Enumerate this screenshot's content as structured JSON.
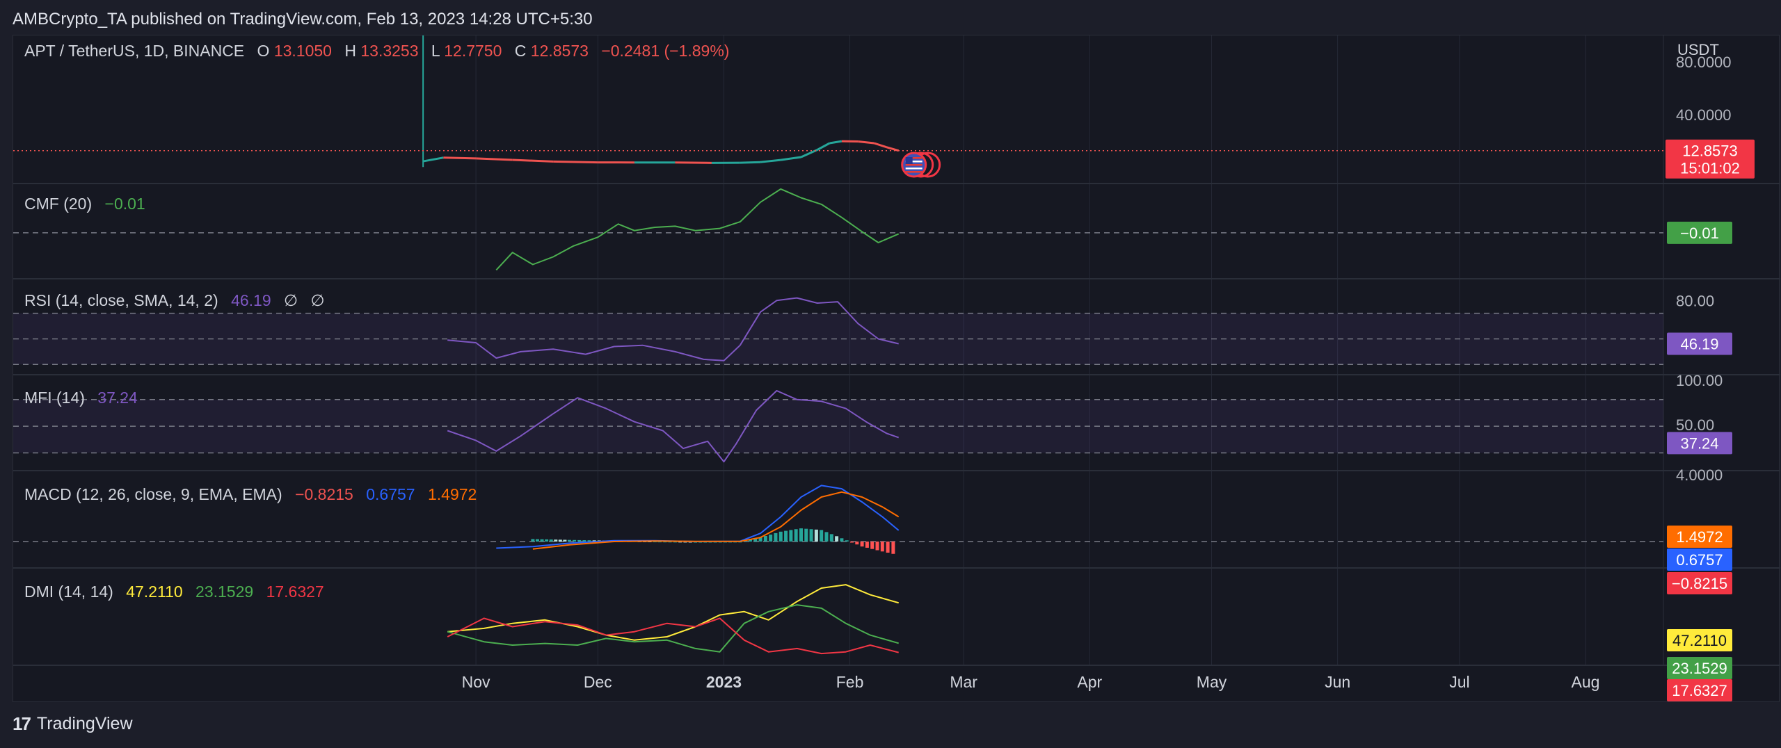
{
  "header": {
    "published": "AMBCrypto_TA published on TradingView.com, Feb 13, 2023 14:28 UTC+5:30"
  },
  "footer": {
    "brand": "TradingView",
    "logo_icon": "tradingview-logo-icon"
  },
  "colors": {
    "background": "#161822",
    "grid": "#252936",
    "up": "#26a69a",
    "down": "#ef5350",
    "cmf": "#4caf50",
    "rsi": "#7e57c2",
    "mfi": "#7e57c2",
    "macd": "#2962ff",
    "signal": "#ff6d00",
    "adx": "#ffeb3b",
    "plus_di": "#4caf50",
    "minus_di": "#f23645"
  },
  "x_axis": [
    "Nov",
    "Dec",
    "2023",
    "Feb",
    "Mar",
    "Apr",
    "May",
    "Jun",
    "Jul",
    "Aug"
  ],
  "chart_data": [
    {
      "type": "line",
      "panel": "price",
      "title": "APT / TetherUS, 1D, BINANCE",
      "ohlc": {
        "o_label": "O",
        "o": "13.1050",
        "h_label": "H",
        "h": "13.3253",
        "l_label": "L",
        "l": "12.7750",
        "c_label": "C",
        "c": "12.8573",
        "change": "−0.2481 (−1.89%)"
      },
      "unit": "USDT",
      "y_ticks": [
        "80.0000",
        "40.0000"
      ],
      "last_price": "12.8573",
      "countdown": "15:01:02",
      "event_icon": "us-flag-icon",
      "x": [
        "2022-10-19",
        "2022-10-24",
        "2022-11-01",
        "2022-11-10",
        "2022-11-20",
        "2022-12-01",
        "2022-12-10",
        "2022-12-20",
        "2022-12-29",
        "2023-01-05",
        "2023-01-10",
        "2023-01-15",
        "2023-01-20",
        "2023-01-24",
        "2023-01-27",
        "2023-01-30",
        "2023-02-03",
        "2023-02-07",
        "2023-02-10",
        "2023-02-13"
      ],
      "series": [
        {
          "values": [
            4.8,
            7.6,
            7.0,
            5.9,
            4.6,
            4.0,
            3.9,
            3.9,
            3.6,
            3.7,
            4.2,
            5.8,
            8.0,
            13.5,
            18.5,
            20.0,
            19.8,
            18.5,
            15.5,
            12.86
          ]
        }
      ],
      "spike": {
        "x": "2022-10-19",
        "high": 100,
        "low": 0.5
      }
    },
    {
      "type": "line",
      "panel": "cmf",
      "title": "CMF (20)",
      "value_label": "−0.01",
      "x": [
        "2022-11-06",
        "2022-11-10",
        "2022-11-15",
        "2022-11-20",
        "2022-11-25",
        "2022-12-01",
        "2022-12-06",
        "2022-12-10",
        "2022-12-15",
        "2022-12-20",
        "2022-12-25",
        "2022-12-31",
        "2023-01-05",
        "2023-01-10",
        "2023-01-15",
        "2023-01-20",
        "2023-01-25",
        "2023-01-30",
        "2023-02-04",
        "2023-02-08",
        "2023-02-13"
      ],
      "series": [
        {
          "values": [
            -0.34,
            -0.18,
            -0.29,
            -0.22,
            -0.12,
            -0.04,
            0.08,
            0.02,
            0.05,
            0.06,
            0.02,
            0.04,
            0.1,
            0.28,
            0.4,
            0.32,
            0.26,
            0.14,
            0.01,
            -0.09,
            -0.01
          ]
        }
      ],
      "y_range": [
        -0.42,
        0.45
      ]
    },
    {
      "type": "line",
      "panel": "rsi",
      "title": "RSI (14, close, SMA, 14, 2)",
      "value_label": "46.19",
      "extra_labels": [
        "∅",
        "∅"
      ],
      "y_ticks": [
        "80.00"
      ],
      "bands": [
        70,
        50,
        30
      ],
      "x": [
        "2022-10-25",
        "2022-11-01",
        "2022-11-06",
        "2022-11-12",
        "2022-11-20",
        "2022-11-28",
        "2022-12-05",
        "2022-12-12",
        "2022-12-20",
        "2022-12-27",
        "2023-01-01",
        "2023-01-05",
        "2023-01-10",
        "2023-01-14",
        "2023-01-19",
        "2023-01-24",
        "2023-01-29",
        "2023-02-03",
        "2023-02-08",
        "2023-02-13"
      ],
      "series": [
        {
          "values": [
            49,
            47,
            35,
            40,
            42,
            38,
            44,
            45,
            40,
            34,
            33,
            45,
            71,
            80,
            82,
            78,
            79,
            62,
            50,
            46.19
          ]
        }
      ],
      "y_range": [
        22,
        97
      ]
    },
    {
      "type": "line",
      "panel": "mfi",
      "title": "MFI (14)",
      "value_label": "37.24",
      "y_ticks": [
        "100.00",
        "50.00"
      ],
      "bands": [
        80,
        50,
        20
      ],
      "x": [
        "2022-10-25",
        "2022-11-01",
        "2022-11-06",
        "2022-11-12",
        "2022-11-20",
        "2022-11-26",
        "2022-12-03",
        "2022-12-10",
        "2022-12-17",
        "2022-12-22",
        "2022-12-28",
        "2023-01-01",
        "2023-01-04",
        "2023-01-09",
        "2023-01-14",
        "2023-01-19",
        "2023-01-25",
        "2023-01-31",
        "2023-02-05",
        "2023-02-10",
        "2023-02-13"
      ],
      "series": [
        {
          "values": [
            45,
            34,
            22,
            39,
            64,
            82,
            70,
            55,
            45,
            25,
            33,
            10,
            30,
            68,
            90,
            80,
            78,
            70,
            55,
            42,
            37.24
          ]
        }
      ],
      "y_range": [
        0,
        108
      ]
    },
    {
      "type": "bar",
      "panel": "macd",
      "title": "MACD (12, 26, close, 9, EMA, EMA)",
      "histogram_label": "−0.8215",
      "macd_label": "0.6757",
      "signal_label": "1.4972",
      "y_ticks": [
        "4.0000"
      ],
      "x": [
        "2022-11-06",
        "2022-11-15",
        "2022-11-24",
        "2022-12-05",
        "2022-12-15",
        "2022-12-25",
        "2023-01-05",
        "2023-01-10",
        "2023-01-15",
        "2023-01-20",
        "2023-01-25",
        "2023-01-30",
        "2023-02-04",
        "2023-02-09",
        "2023-02-13"
      ],
      "series": [
        {
          "name": "MACD",
          "values": [
            -0.4,
            -0.3,
            -0.1,
            0.05,
            0.05,
            0.0,
            0.02,
            0.5,
            1.5,
            2.7,
            3.4,
            3.2,
            2.4,
            1.5,
            0.68
          ]
        },
        {
          "name": "Signal",
          "values": [
            null,
            -0.45,
            -0.2,
            0.0,
            0.03,
            0.01,
            0.01,
            0.25,
            0.9,
            1.9,
            2.7,
            3.0,
            2.7,
            2.1,
            1.5
          ]
        },
        {
          "name": "Histogram",
          "values": [
            null,
            0.15,
            0.1,
            0.05,
            0.02,
            0.0,
            0.01,
            0.25,
            0.6,
            0.8,
            0.7,
            0.2,
            -0.3,
            -0.6,
            -0.82
          ]
        }
      ],
      "y_range": [
        -1.6,
        4.3
      ]
    },
    {
      "type": "line",
      "panel": "dmi",
      "title": "DMI (14, 14)",
      "adx_label": "47.2110",
      "plus_label": "23.1529",
      "minus_label": "17.6327",
      "x": [
        "2022-10-25",
        "2022-11-03",
        "2022-11-10",
        "2022-11-18",
        "2022-11-26",
        "2022-12-03",
        "2022-12-10",
        "2022-12-18",
        "2022-12-25",
        "2022-12-31",
        "2023-01-06",
        "2023-01-12",
        "2023-01-19",
        "2023-01-25",
        "2023-01-31",
        "2023-02-06",
        "2023-02-13"
      ],
      "series": [
        {
          "name": "ADX",
          "values": [
            30,
            32,
            35,
            37,
            33,
            28,
            25,
            27,
            33,
            40,
            42,
            37,
            48,
            56,
            58,
            52,
            47.21
          ]
        },
        {
          "name": "+DI",
          "values": [
            30,
            24,
            22,
            23,
            22,
            26,
            24,
            25,
            20,
            18,
            35,
            42,
            46,
            44,
            35,
            28,
            23.15
          ]
        },
        {
          "name": "−DI",
          "values": [
            27,
            38,
            33,
            36,
            34,
            28,
            30,
            35,
            33,
            38,
            25,
            18,
            20,
            17,
            18,
            22,
            17.63
          ]
        }
      ],
      "y_range": [
        10,
        68
      ]
    }
  ]
}
